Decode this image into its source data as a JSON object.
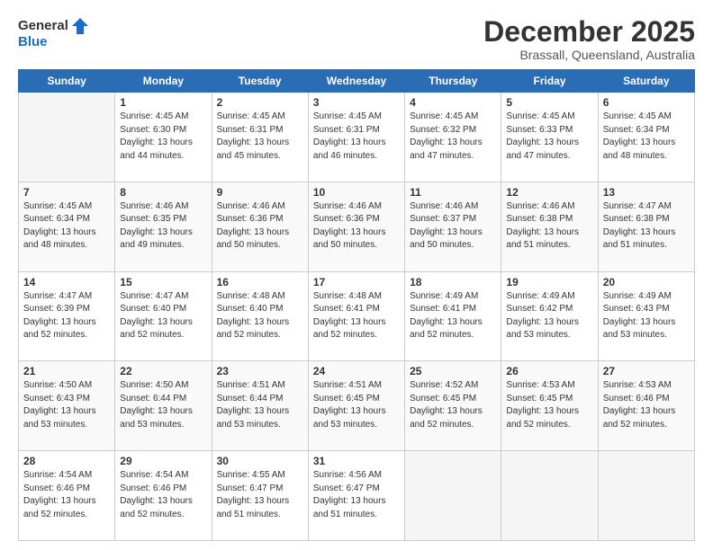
{
  "logo": {
    "general": "General",
    "blue": "Blue"
  },
  "header": {
    "month": "December 2025",
    "location": "Brassall, Queensland, Australia"
  },
  "weekdays": [
    "Sunday",
    "Monday",
    "Tuesday",
    "Wednesday",
    "Thursday",
    "Friday",
    "Saturday"
  ],
  "weeks": [
    [
      {
        "day": "",
        "info": ""
      },
      {
        "day": "1",
        "info": "Sunrise: 4:45 AM\nSunset: 6:30 PM\nDaylight: 13 hours\nand 44 minutes."
      },
      {
        "day": "2",
        "info": "Sunrise: 4:45 AM\nSunset: 6:31 PM\nDaylight: 13 hours\nand 45 minutes."
      },
      {
        "day": "3",
        "info": "Sunrise: 4:45 AM\nSunset: 6:31 PM\nDaylight: 13 hours\nand 46 minutes."
      },
      {
        "day": "4",
        "info": "Sunrise: 4:45 AM\nSunset: 6:32 PM\nDaylight: 13 hours\nand 47 minutes."
      },
      {
        "day": "5",
        "info": "Sunrise: 4:45 AM\nSunset: 6:33 PM\nDaylight: 13 hours\nand 47 minutes."
      },
      {
        "day": "6",
        "info": "Sunrise: 4:45 AM\nSunset: 6:34 PM\nDaylight: 13 hours\nand 48 minutes."
      }
    ],
    [
      {
        "day": "7",
        "info": "Sunrise: 4:45 AM\nSunset: 6:34 PM\nDaylight: 13 hours\nand 48 minutes."
      },
      {
        "day": "8",
        "info": "Sunrise: 4:46 AM\nSunset: 6:35 PM\nDaylight: 13 hours\nand 49 minutes."
      },
      {
        "day": "9",
        "info": "Sunrise: 4:46 AM\nSunset: 6:36 PM\nDaylight: 13 hours\nand 50 minutes."
      },
      {
        "day": "10",
        "info": "Sunrise: 4:46 AM\nSunset: 6:36 PM\nDaylight: 13 hours\nand 50 minutes."
      },
      {
        "day": "11",
        "info": "Sunrise: 4:46 AM\nSunset: 6:37 PM\nDaylight: 13 hours\nand 50 minutes."
      },
      {
        "day": "12",
        "info": "Sunrise: 4:46 AM\nSunset: 6:38 PM\nDaylight: 13 hours\nand 51 minutes."
      },
      {
        "day": "13",
        "info": "Sunrise: 4:47 AM\nSunset: 6:38 PM\nDaylight: 13 hours\nand 51 minutes."
      }
    ],
    [
      {
        "day": "14",
        "info": "Sunrise: 4:47 AM\nSunset: 6:39 PM\nDaylight: 13 hours\nand 52 minutes."
      },
      {
        "day": "15",
        "info": "Sunrise: 4:47 AM\nSunset: 6:40 PM\nDaylight: 13 hours\nand 52 minutes."
      },
      {
        "day": "16",
        "info": "Sunrise: 4:48 AM\nSunset: 6:40 PM\nDaylight: 13 hours\nand 52 minutes."
      },
      {
        "day": "17",
        "info": "Sunrise: 4:48 AM\nSunset: 6:41 PM\nDaylight: 13 hours\nand 52 minutes."
      },
      {
        "day": "18",
        "info": "Sunrise: 4:49 AM\nSunset: 6:41 PM\nDaylight: 13 hours\nand 52 minutes."
      },
      {
        "day": "19",
        "info": "Sunrise: 4:49 AM\nSunset: 6:42 PM\nDaylight: 13 hours\nand 53 minutes."
      },
      {
        "day": "20",
        "info": "Sunrise: 4:49 AM\nSunset: 6:43 PM\nDaylight: 13 hours\nand 53 minutes."
      }
    ],
    [
      {
        "day": "21",
        "info": "Sunrise: 4:50 AM\nSunset: 6:43 PM\nDaylight: 13 hours\nand 53 minutes."
      },
      {
        "day": "22",
        "info": "Sunrise: 4:50 AM\nSunset: 6:44 PM\nDaylight: 13 hours\nand 53 minutes."
      },
      {
        "day": "23",
        "info": "Sunrise: 4:51 AM\nSunset: 6:44 PM\nDaylight: 13 hours\nand 53 minutes."
      },
      {
        "day": "24",
        "info": "Sunrise: 4:51 AM\nSunset: 6:45 PM\nDaylight: 13 hours\nand 53 minutes."
      },
      {
        "day": "25",
        "info": "Sunrise: 4:52 AM\nSunset: 6:45 PM\nDaylight: 13 hours\nand 52 minutes."
      },
      {
        "day": "26",
        "info": "Sunrise: 4:53 AM\nSunset: 6:45 PM\nDaylight: 13 hours\nand 52 minutes."
      },
      {
        "day": "27",
        "info": "Sunrise: 4:53 AM\nSunset: 6:46 PM\nDaylight: 13 hours\nand 52 minutes."
      }
    ],
    [
      {
        "day": "28",
        "info": "Sunrise: 4:54 AM\nSunset: 6:46 PM\nDaylight: 13 hours\nand 52 minutes."
      },
      {
        "day": "29",
        "info": "Sunrise: 4:54 AM\nSunset: 6:46 PM\nDaylight: 13 hours\nand 52 minutes."
      },
      {
        "day": "30",
        "info": "Sunrise: 4:55 AM\nSunset: 6:47 PM\nDaylight: 13 hours\nand 51 minutes."
      },
      {
        "day": "31",
        "info": "Sunrise: 4:56 AM\nSunset: 6:47 PM\nDaylight: 13 hours\nand 51 minutes."
      },
      {
        "day": "",
        "info": ""
      },
      {
        "day": "",
        "info": ""
      },
      {
        "day": "",
        "info": ""
      }
    ]
  ]
}
